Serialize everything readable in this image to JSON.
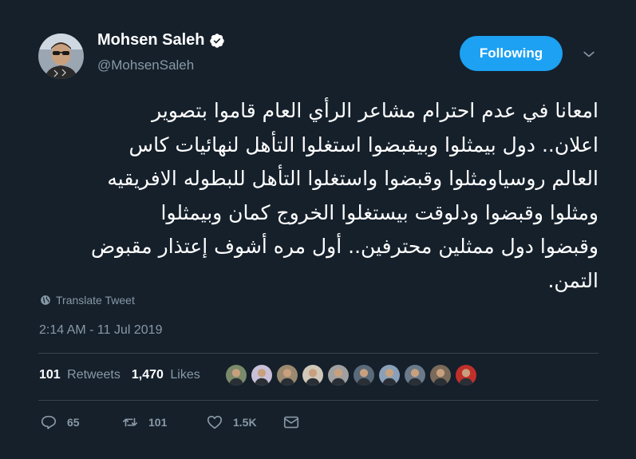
{
  "author": {
    "display_name": "Mohsen Saleh",
    "handle": "@MohsenSaleh",
    "verified": true,
    "avatar_icon": "profile-photo"
  },
  "follow_button": {
    "label": "Following",
    "color": "#1da1f2"
  },
  "tweet": {
    "lines": [
      "امعانا في عدم احترام مشاعر الرأي العام قاموا بتصوير",
      "اعلان.. دول بيمثلوا وبيقبضوا استغلوا التأهل لنهائيات كاس",
      "العالم روسياومثلوا وقبضوا واستغلوا التأهل للبطوله الافريقيه",
      "ومثلوا وقبضوا ودلوقت بيستغلوا الخروج كمان وبيمثلوا",
      "وقبضوا دول ممثلين محترفين.. أول مره أشوف إعتذار مقبوض",
      "التمن."
    ]
  },
  "translate": {
    "label": "Translate Tweet",
    "icon": "globe-icon"
  },
  "timestamp": "2:14 AM - 11 Jul 2019",
  "stats": {
    "retweets_count": "101",
    "retweets_label": "Retweets",
    "likes_count": "1,470",
    "likes_label": "Likes"
  },
  "liker_avatars": [
    {
      "color": "#7a8a6a"
    },
    {
      "color": "#c9c0d8"
    },
    {
      "color": "#9a8a70"
    },
    {
      "color": "#d0c8b8"
    },
    {
      "color": "#a0a0a0"
    },
    {
      "color": "#5a6a7a"
    },
    {
      "color": "#8aa0b8"
    },
    {
      "color": "#6a7a8a"
    },
    {
      "color": "#7a6a5a"
    },
    {
      "color": "#c0302a"
    }
  ],
  "actions": {
    "reply_count": "65",
    "retweet_count": "101",
    "like_count": "1.5K"
  },
  "colors": {
    "background": "#15202b",
    "text_secondary": "#8899a6",
    "divider": "#38444d",
    "accent": "#1da1f2"
  }
}
